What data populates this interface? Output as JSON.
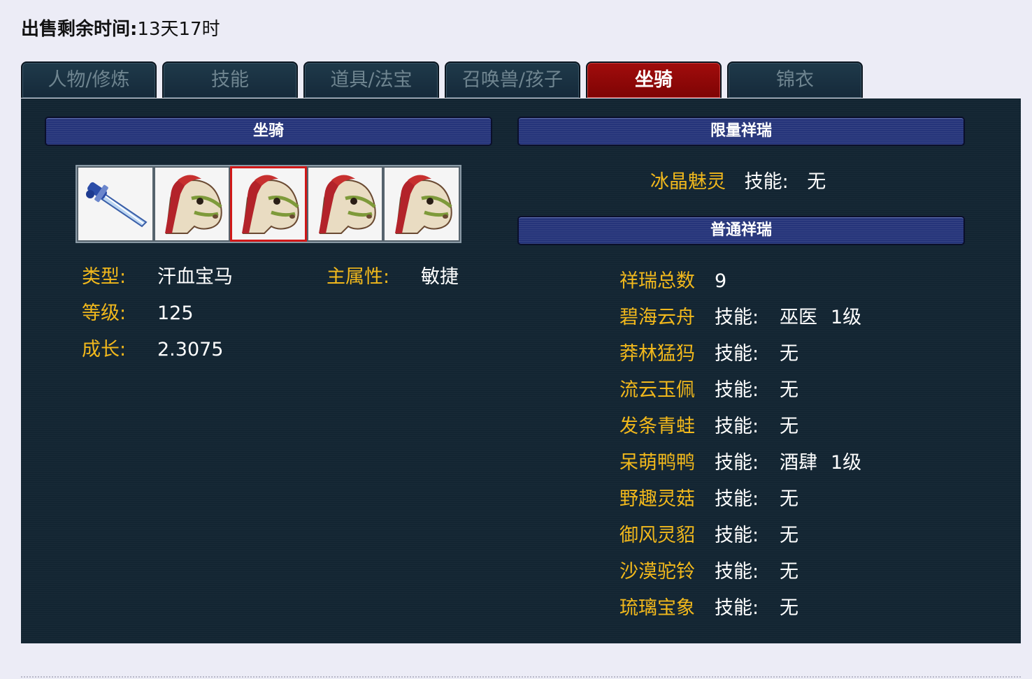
{
  "sale": {
    "label": "出售剩余时间:",
    "value": "13天17时"
  },
  "tabs": [
    {
      "label": "人物/修炼"
    },
    {
      "label": "技能"
    },
    {
      "label": "道具/法宝"
    },
    {
      "label": "召唤兽/孩子"
    },
    {
      "label": "坐骑",
      "active": true
    },
    {
      "label": "锦衣"
    }
  ],
  "mount": {
    "title": "坐骑",
    "slot_icons": [
      "sword-icon",
      "horse-icon",
      "horse-icon",
      "horse-icon",
      "horse-icon"
    ],
    "selected_slot": 2,
    "type_label": "类型:",
    "type_value": "汗血宝马",
    "main_attr_label": "主属性:",
    "main_attr_value": "敏捷",
    "level_label": "等级:",
    "level_value": "125",
    "growth_label": "成长:",
    "growth_value": "2.3075"
  },
  "limited": {
    "title": "限量祥瑞",
    "items": [
      {
        "name": "冰晶魅灵",
        "skill_label": "技能:",
        "skill": "无"
      }
    ]
  },
  "normal": {
    "title": "普通祥瑞",
    "total_label": "祥瑞总数",
    "total_value": "9",
    "items": [
      {
        "name": "碧海云舟",
        "skill_label": "技能:",
        "skill": "巫医",
        "level": "1级"
      },
      {
        "name": "莽林猛犸",
        "skill_label": "技能:",
        "skill": "无"
      },
      {
        "name": "流云玉佩",
        "skill_label": "技能:",
        "skill": "无"
      },
      {
        "name": "发条青蛙",
        "skill_label": "技能:",
        "skill": "无"
      },
      {
        "name": "呆萌鸭鸭",
        "skill_label": "技能:",
        "skill": "酒肆",
        "level": "1级"
      },
      {
        "name": "野趣灵菇",
        "skill_label": "技能:",
        "skill": "无"
      },
      {
        "name": "御风灵貂",
        "skill_label": "技能:",
        "skill": "无"
      },
      {
        "name": "沙漠驼铃",
        "skill_label": "技能:",
        "skill": "无"
      },
      {
        "name": "琉璃宝象",
        "skill_label": "技能:",
        "skill": "无"
      }
    ]
  },
  "colors": {
    "accent_gold": "#f1b81c",
    "tab_active": "#8b0707",
    "panel_bg": "#132532",
    "bar_bg": "#25347a"
  }
}
